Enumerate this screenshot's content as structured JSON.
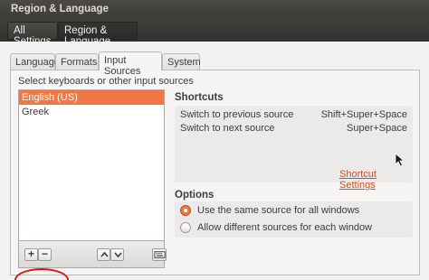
{
  "window": {
    "title": "Region & Language"
  },
  "pathbar": {
    "crumbs": [
      "All Settings",
      "Region & Language"
    ]
  },
  "tabs": [
    {
      "label": "Language"
    },
    {
      "label": "Formats"
    },
    {
      "label": "Input Sources",
      "active": true
    },
    {
      "label": "System"
    }
  ],
  "sources": {
    "prompt": "Select keyboards or other input sources",
    "items": [
      {
        "label": "English (US)",
        "selected": true
      },
      {
        "label": "Greek",
        "selected": false
      }
    ],
    "toolbar": {
      "add_label": "+",
      "remove_label": "−",
      "up_icon": "chevron-up-icon",
      "down_icon": "chevron-down-icon",
      "keyboard_icon": "keyboard-icon"
    }
  },
  "shortcuts": {
    "title": "Shortcuts",
    "rows": [
      {
        "label": "Switch to previous source",
        "accel": "Shift+Super+Space"
      },
      {
        "label": "Switch to next source",
        "accel": "Super+Space"
      }
    ],
    "link": "Shortcut Settings"
  },
  "options": {
    "title": "Options",
    "radios": [
      {
        "label": "Use the same source for all windows",
        "checked": true
      },
      {
        "label": "Allow different sources for each window",
        "checked": false
      }
    ]
  },
  "colors": {
    "accent": "#f07746",
    "link": "#dd4814",
    "highlight_oval": "#d4191b"
  }
}
